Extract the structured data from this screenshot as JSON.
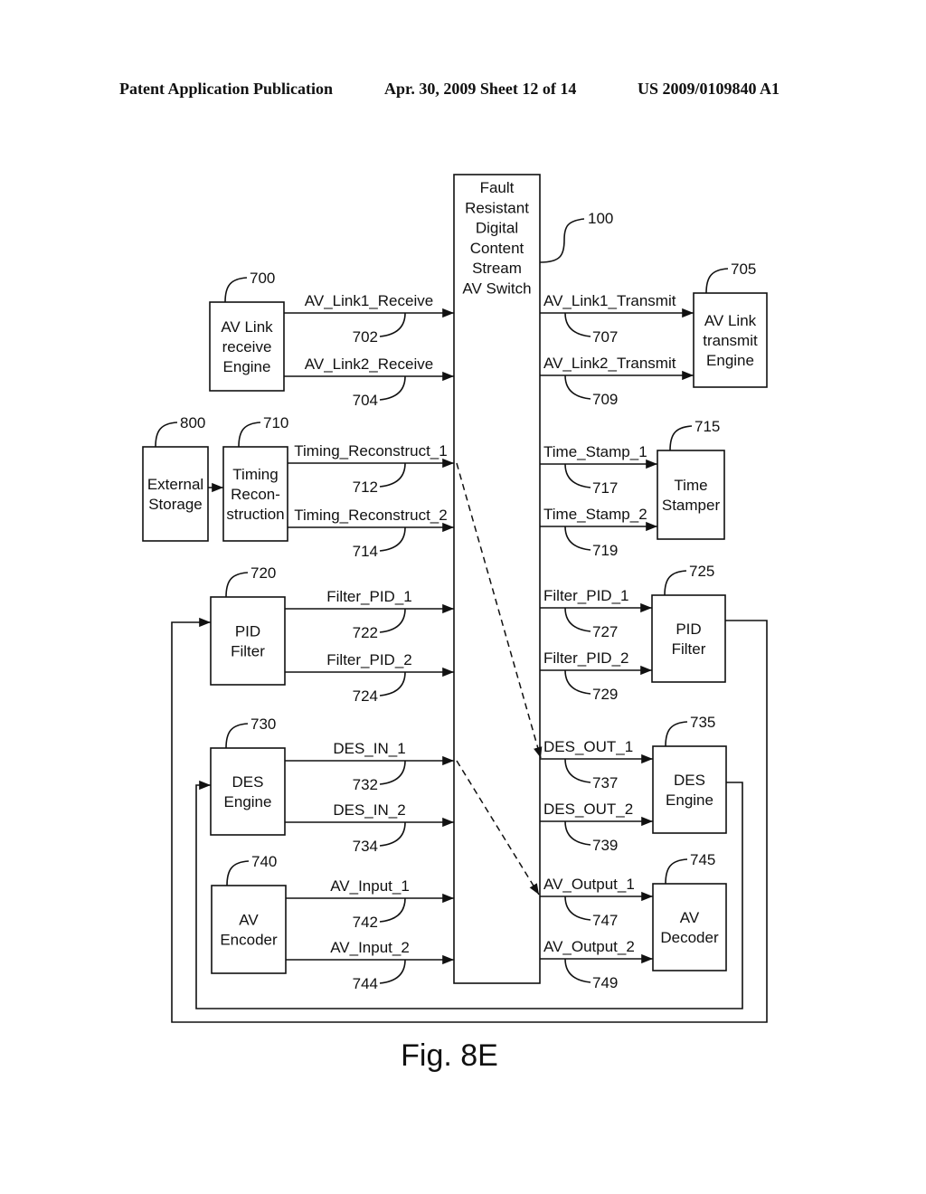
{
  "header": {
    "left": "Patent Application Publication",
    "middle": "Apr. 30, 2009  Sheet 12 of 14",
    "right": "US 2009/0109840 A1"
  },
  "figure_label": "Fig. 8E",
  "switch": {
    "ref": "100",
    "lines": [
      "Fault",
      "Resistant",
      "Digital",
      "Content",
      "Stream",
      "AV Switch"
    ]
  },
  "left_blocks": [
    {
      "id": "av_link_rx",
      "ref": "700",
      "lines": [
        "AV Link",
        "receive",
        "Engine"
      ],
      "signals": [
        {
          "label": "AV_Link1_Receive",
          "ref": "702"
        },
        {
          "label": "AV_Link2_Receive",
          "ref": "704"
        }
      ]
    },
    {
      "id": "timing",
      "ref": "710",
      "lines": [
        "Timing",
        "Recon-",
        "struction"
      ],
      "signals": [
        {
          "label": "Timing_Reconstruct_1",
          "ref": "712"
        },
        {
          "label": "Timing_Reconstruct_2",
          "ref": "714"
        }
      ]
    },
    {
      "id": "pid_in",
      "ref": "720",
      "lines": [
        "PID",
        "Filter"
      ],
      "signals": [
        {
          "label": "Filter_PID_1",
          "ref": "722"
        },
        {
          "label": "Filter_PID_2",
          "ref": "724"
        }
      ]
    },
    {
      "id": "des_in",
      "ref": "730",
      "lines": [
        "DES",
        "Engine"
      ],
      "signals": [
        {
          "label": "DES_IN_1",
          "ref": "732"
        },
        {
          "label": "DES_IN_2",
          "ref": "734"
        }
      ]
    },
    {
      "id": "encoder",
      "ref": "740",
      "lines": [
        "AV",
        "Encoder"
      ],
      "signals": [
        {
          "label": "AV_Input_1",
          "ref": "742"
        },
        {
          "label": "AV_Input_2",
          "ref": "744"
        }
      ]
    }
  ],
  "external_storage": {
    "ref": "800",
    "lines": [
      "External",
      "Storage"
    ]
  },
  "right_blocks": [
    {
      "id": "av_link_tx",
      "ref": "705",
      "lines": [
        "AV Link",
        "transmit",
        "Engine"
      ],
      "signals": [
        {
          "label": "AV_Link1_Transmit",
          "ref": "707"
        },
        {
          "label": "AV_Link2_Transmit",
          "ref": "709"
        }
      ]
    },
    {
      "id": "stamper",
      "ref": "715",
      "lines": [
        "Time",
        "Stamper"
      ],
      "signals": [
        {
          "label": "Time_Stamp_1",
          "ref": "717"
        },
        {
          "label": "Time_Stamp_2",
          "ref": "719"
        }
      ]
    },
    {
      "id": "pid_out",
      "ref": "725",
      "lines": [
        "PID",
        "Filter"
      ],
      "signals": [
        {
          "label": "Filter_PID_1",
          "ref": "727"
        },
        {
          "label": "Filter_PID_2",
          "ref": "729"
        }
      ]
    },
    {
      "id": "des_out",
      "ref": "735",
      "lines": [
        "DES",
        "Engine"
      ],
      "signals": [
        {
          "label": "DES_OUT_1",
          "ref": "737"
        },
        {
          "label": "DES_OUT_2",
          "ref": "739"
        }
      ]
    },
    {
      "id": "decoder",
      "ref": "745",
      "lines": [
        "AV",
        "Decoder"
      ],
      "signals": [
        {
          "label": "AV_Output_1",
          "ref": "747"
        },
        {
          "label": "AV_Output_2",
          "ref": "749"
        }
      ]
    }
  ]
}
